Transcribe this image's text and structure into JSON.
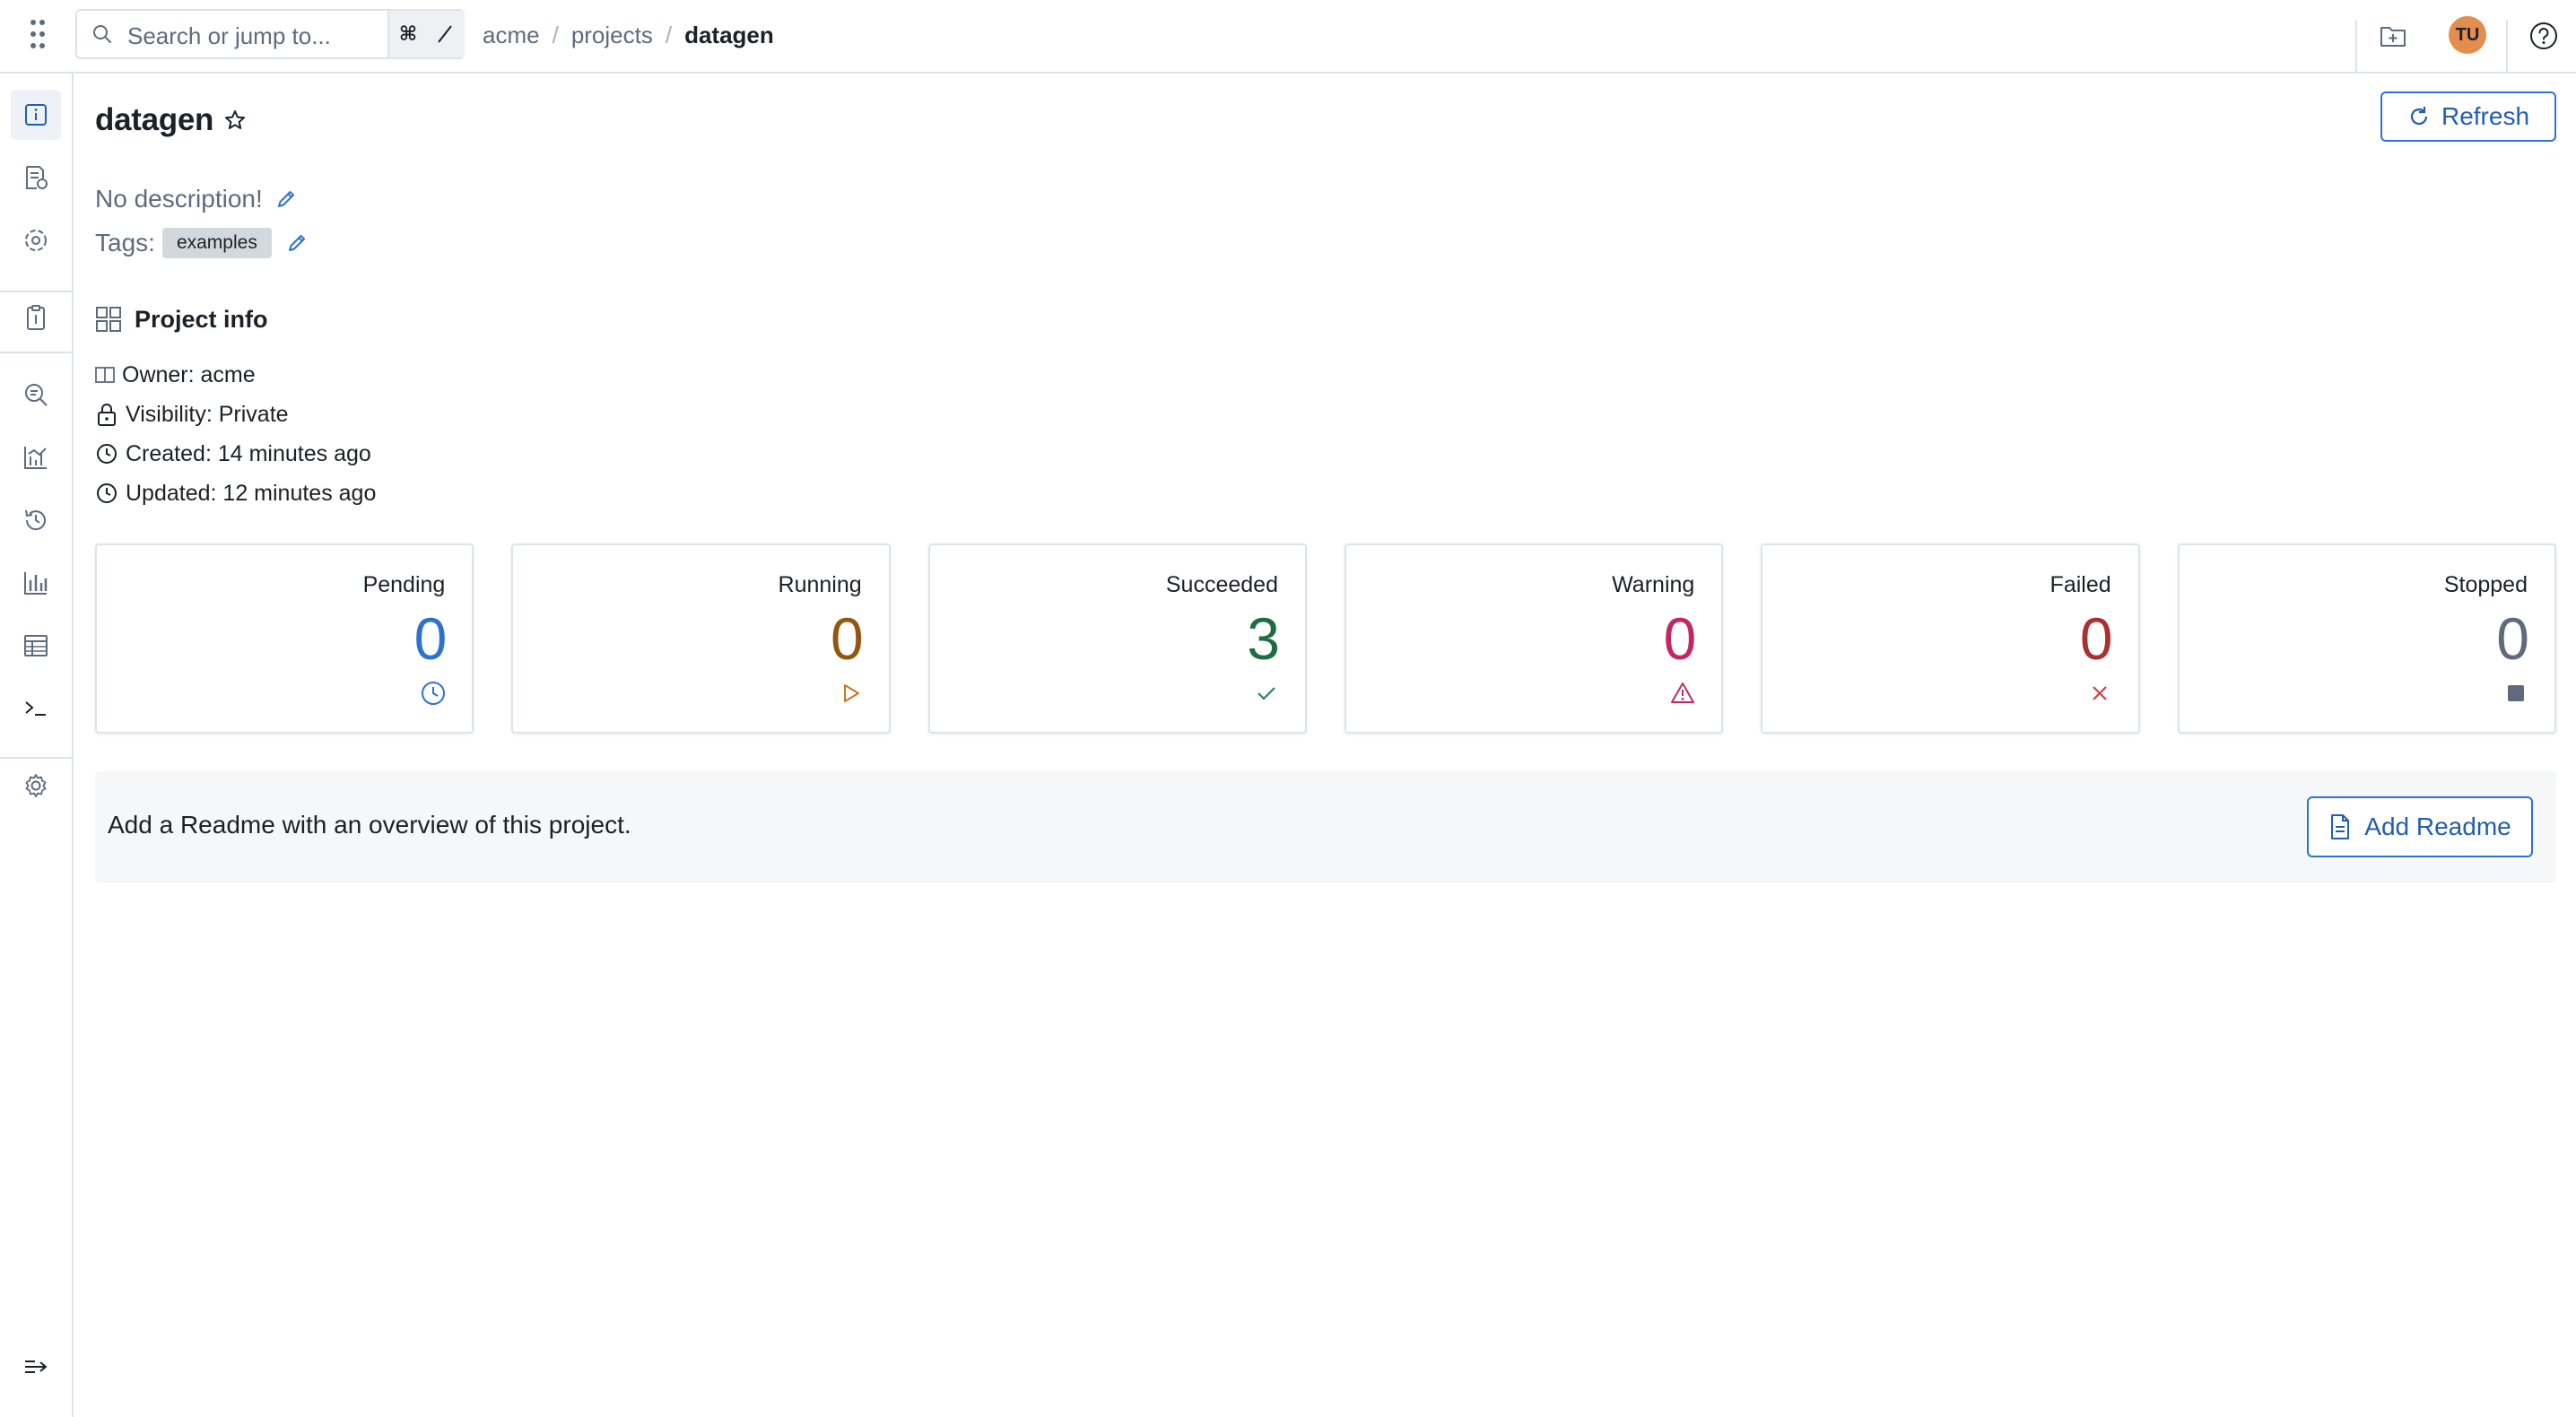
{
  "search": {
    "placeholder": "Search or jump to...",
    "shortcut_key": "⌘",
    "shortcut_slash": "/"
  },
  "breadcrumb": [
    "acme",
    "projects",
    "datagen"
  ],
  "header": {
    "avatar_initials": "TU"
  },
  "page": {
    "title": "datagen",
    "refresh_label": "Refresh",
    "description": "No description!",
    "tags_label": "Tags:",
    "tags": [
      "examples"
    ]
  },
  "project_info": {
    "title": "Project info",
    "owner": "Owner: acme",
    "visibility": "Visibility: Private",
    "created": "Created: 14 minutes ago",
    "updated": "Updated: 12 minutes ago"
  },
  "status_cards": [
    {
      "label": "Pending",
      "count": "0",
      "color": "#2d72d2",
      "icon": "clock-icon"
    },
    {
      "label": "Running",
      "count": "0",
      "color": "#935610",
      "icon": "play-icon"
    },
    {
      "label": "Succeeded",
      "count": "3",
      "color": "#1c6e42",
      "icon": "check-icon"
    },
    {
      "label": "Warning",
      "count": "0",
      "color": "#c22762",
      "icon": "warning-icon"
    },
    {
      "label": "Failed",
      "count": "0",
      "color": "#ac2f33",
      "icon": "cross-icon"
    },
    {
      "label": "Stopped",
      "count": "0",
      "color": "#5f6b7c",
      "icon": "stop-icon"
    }
  ],
  "readme": {
    "text": "Add a Readme with an overview of this project.",
    "button_label": "Add Readme"
  },
  "sidenav": {
    "items": [
      "info-icon",
      "runs-icon",
      "components-icon",
      "clipboard-icon",
      "search-icon",
      "dashboard-icon",
      "history-icon",
      "bar-chart-icon",
      "table-icon",
      "terminal-icon",
      "settings-icon",
      "collapse-icon"
    ]
  }
}
